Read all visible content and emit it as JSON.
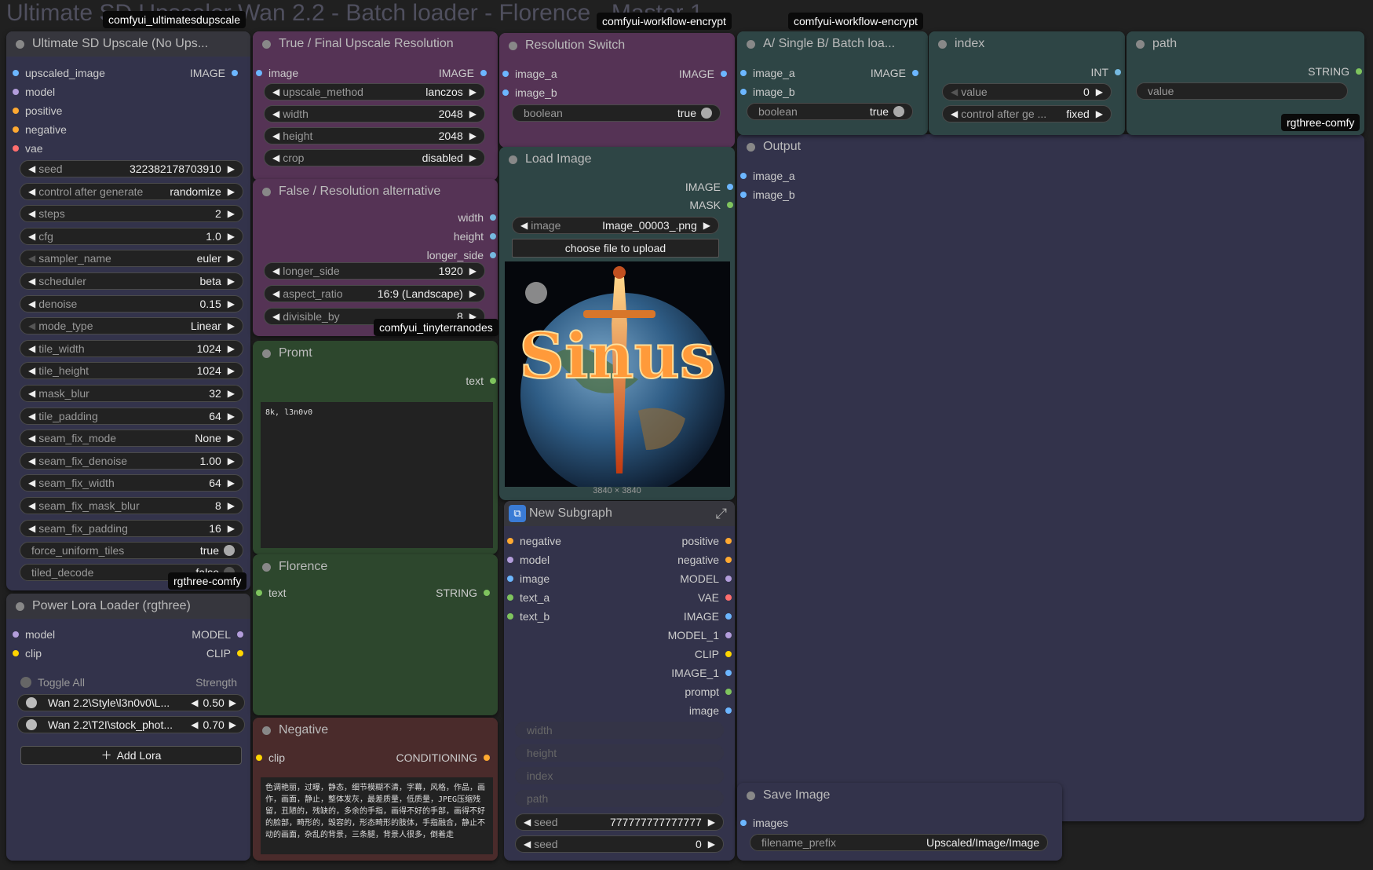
{
  "bg_title": "Ultimate SD Upscaler Wan 2.2 - Batch loader - Florence - Master 1",
  "tags": {
    "ultimate": "comfyui_ultimatesdupscale",
    "encrypt1": "comfyui-workflow-encrypt",
    "encrypt2": "comfyui-workflow-encrypt",
    "tinyterra": "comfyui_tinyterranodes",
    "rgthree_upscale": "rgthree-comfy",
    "rgthree_path": "rgthree-comfy"
  },
  "upscale": {
    "title": "Ultimate SD Upscale (No Ups...",
    "inputs": [
      {
        "label": "upscaled_image",
        "type": "IMAGE"
      },
      {
        "label": "model"
      },
      {
        "label": "positive"
      },
      {
        "label": "negative"
      },
      {
        "label": "vae"
      }
    ],
    "widgets": [
      {
        "label": "seed",
        "value": "322382178703910"
      },
      {
        "label": "control after generate",
        "value": "randomize"
      },
      {
        "label": "steps",
        "value": "2"
      },
      {
        "label": "cfg",
        "value": "1.0"
      },
      {
        "label": "sampler_name",
        "value": "euler"
      },
      {
        "label": "scheduler",
        "value": "beta"
      },
      {
        "label": "denoise",
        "value": "0.15"
      },
      {
        "label": "mode_type",
        "value": "Linear"
      },
      {
        "label": "tile_width",
        "value": "1024"
      },
      {
        "label": "tile_height",
        "value": "1024"
      },
      {
        "label": "mask_blur",
        "value": "32"
      },
      {
        "label": "tile_padding",
        "value": "64"
      },
      {
        "label": "seam_fix_mode",
        "value": "None"
      },
      {
        "label": "seam_fix_denoise",
        "value": "1.00"
      },
      {
        "label": "seam_fix_width",
        "value": "64"
      },
      {
        "label": "seam_fix_mask_blur",
        "value": "8"
      },
      {
        "label": "seam_fix_padding",
        "value": "16"
      }
    ],
    "toggles": [
      {
        "label": "force_uniform_tiles",
        "value": "true"
      },
      {
        "label": "tiled_decode",
        "value": "false"
      }
    ]
  },
  "lora": {
    "title": "Power Lora Loader (rgthree)",
    "inputs": [
      {
        "label": "model",
        "type": "MODEL"
      },
      {
        "label": "clip",
        "type": "CLIP"
      }
    ],
    "toggle_all": "Toggle All",
    "strength": "Strength",
    "items": [
      {
        "name": "Wan 2.2\\Style\\l3n0v0\\L...",
        "value": "0.50"
      },
      {
        "name": "Wan 2.2\\T2I\\stock_phot...",
        "value": "0.70"
      }
    ],
    "add": "Add Lora"
  },
  "truefinal": {
    "title": "True / Final Upscale Resolution",
    "input": {
      "label": "image",
      "type": "IMAGE"
    },
    "widgets": [
      {
        "label": "upscale_method",
        "value": "lanczos"
      },
      {
        "label": "width",
        "value": "2048"
      },
      {
        "label": "height",
        "value": "2048"
      },
      {
        "label": "crop",
        "value": "disabled"
      }
    ]
  },
  "falseres": {
    "title": "False / Resolution alternative",
    "outputs": [
      "width",
      "height",
      "longer_side"
    ],
    "widgets": [
      {
        "label": "longer_side",
        "value": "1920"
      },
      {
        "label": "aspect_ratio",
        "value": "16:9 (Landscape)"
      },
      {
        "label": "divisible_by",
        "value": "8"
      }
    ]
  },
  "promt": {
    "title": "Promt",
    "output": "text",
    "text": "8k, l3n0v0"
  },
  "florence": {
    "title": "Florence",
    "input": "text",
    "output": "STRING"
  },
  "negative": {
    "title": "Negative",
    "input": "clip",
    "output": "CONDITIONING",
    "text": "色调艳丽，过曝，静态，细节模糊不清，字幕，风格，作品，画作，画面，静止，整体发灰，最差质量，低质量，JPEG压缩残留，丑陋的，残缺的，多余的手指，画得不好的手部，画得不好的脸部，畸形的，毁容的，形态畸形的肢体，手指融合，静止不动的画面，杂乱的背景，三条腿，背景人很多，倒着走"
  },
  "switch": {
    "title": "Resolution Switch",
    "inputs": [
      {
        "label": "image_a",
        "type": "IMAGE"
      },
      {
        "label": "image_b"
      }
    ],
    "toggle": {
      "label": "boolean",
      "value": "true"
    }
  },
  "load": {
    "title": "Load Image",
    "outputs": [
      "IMAGE",
      "MASK"
    ],
    "image": {
      "label": "image",
      "value": "Image_00003_.png"
    },
    "upload": "choose file to upload",
    "dims": "3840 × 3840",
    "art_text": "Sinus"
  },
  "subgraph": {
    "title": "New Subgraph",
    "inputs": [
      "negative",
      "model",
      "image",
      "text_a",
      "text_b"
    ],
    "outputs": [
      "positive",
      "negative",
      "MODEL",
      "VAE",
      "IMAGE",
      "MODEL_1",
      "CLIP",
      "IMAGE_1",
      "prompt",
      "image"
    ],
    "disabled": [
      "width",
      "height",
      "index",
      "path"
    ],
    "seeds": [
      {
        "label": "seed",
        "value": "777777777777777"
      },
      {
        "label": "seed",
        "value": "0"
      }
    ]
  },
  "ab": {
    "title": "A/ Single B/ Batch loa...",
    "inputs": [
      {
        "label": "image_a",
        "type": "IMAGE"
      },
      {
        "label": "image_b"
      }
    ],
    "toggle": {
      "label": "boolean",
      "value": "true"
    }
  },
  "index": {
    "title": "index",
    "output": "INT",
    "widgets": [
      {
        "label": "value",
        "value": "0"
      },
      {
        "label": "control after ge ...",
        "value": "fixed"
      }
    ]
  },
  "path": {
    "title": "path",
    "output": "STRING",
    "value_label": "value"
  },
  "output": {
    "title": "Output",
    "inputs": [
      "image_a",
      "image_b"
    ]
  },
  "save": {
    "title": "Save Image",
    "input": "images",
    "prefix": {
      "label": "filename_prefix",
      "value": "Upscaled/Image/Image"
    }
  },
  "colors": {
    "purple": "#553355",
    "green": "#2d472d",
    "teal": "#2e4545",
    "red": "#4a2b2b",
    "gray": "#36363d",
    "blue": "#33334b",
    "image": "#6cb6ff",
    "model": "#b39ddb",
    "cond": "#ffa931",
    "vae": "#ff6e6e",
    "clip": "#ffd500",
    "string": "#7fc45e",
    "int": "#76b9e0"
  }
}
